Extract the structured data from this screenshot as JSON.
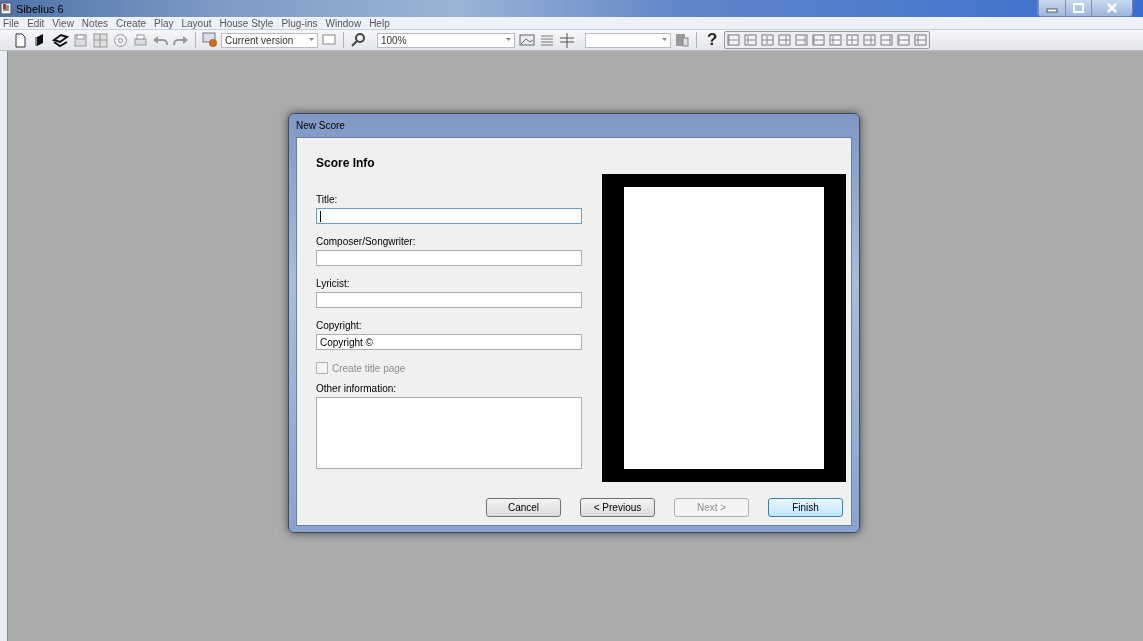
{
  "window": {
    "title": "Sibelius 6"
  },
  "menu": [
    "File",
    "Edit",
    "View",
    "Notes",
    "Create",
    "Play",
    "Layout",
    "House Style",
    "Plug-ins",
    "Window",
    "Help"
  ],
  "toolbar": {
    "version_combo": "Current version",
    "zoom_combo": "100%",
    "help_glyph": "?"
  },
  "dialog": {
    "title": "New Score",
    "heading": "Score Info",
    "fields": [
      {
        "label": "Title:",
        "focused": true
      },
      {
        "label": "Composer/Songwriter:",
        "focused": false
      },
      {
        "label": "Lyricist:",
        "focused": false
      },
      {
        "label": "Copyright:",
        "value": "Copyright ©",
        "focused": false
      }
    ],
    "checkbox": {
      "label": "Create title page",
      "checked": false,
      "disabled": true
    },
    "other": {
      "label": "Other information:"
    },
    "buttons": [
      {
        "label": "Cancel",
        "disabled": false,
        "default": false
      },
      {
        "label": "< Previous",
        "disabled": false,
        "default": false
      },
      {
        "label": "Next >",
        "disabled": true,
        "default": false
      },
      {
        "label": "Finish",
        "disabled": false,
        "default": true
      }
    ]
  }
}
